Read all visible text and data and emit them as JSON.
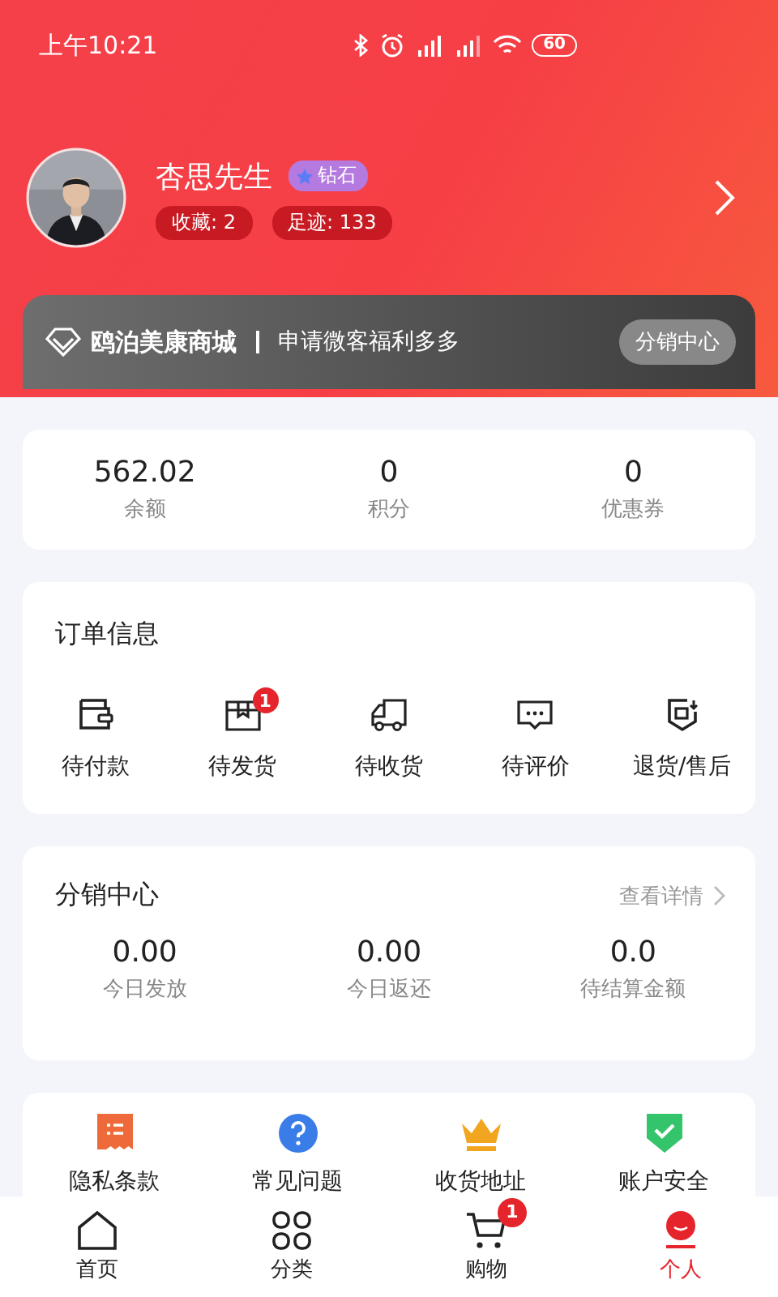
{
  "status_bar": {
    "time": "上午10:21",
    "battery": "60"
  },
  "profile": {
    "name": "杏思先生",
    "level": "钻石",
    "stats": [
      "收藏: 2",
      "足迹: 133"
    ]
  },
  "banner": {
    "shop": "鸥泊美康商城",
    "slogan": "申请微客福利多多",
    "button": "分销中心"
  },
  "assets": [
    {
      "value": "562.02",
      "label": "余额"
    },
    {
      "value": "0",
      "label": "积分"
    },
    {
      "value": "0",
      "label": "优惠券"
    }
  ],
  "orders": {
    "title": "订单信息",
    "items": [
      {
        "kind": "wallet",
        "label": "待付款"
      },
      {
        "kind": "box",
        "label": "待发货",
        "badge": "1"
      },
      {
        "kind": "truck",
        "label": "待收货"
      },
      {
        "kind": "chat",
        "label": "待评价"
      },
      {
        "kind": "return",
        "label": "退货/售后"
      }
    ]
  },
  "distribution": {
    "title": "分销中心",
    "link": "查看详情",
    "stats": [
      {
        "value": "0.00",
        "label": "今日发放"
      },
      {
        "value": "0.00",
        "label": "今日返还"
      },
      {
        "value": "0.0",
        "label": "待结算金额"
      }
    ]
  },
  "services": [
    {
      "kind": "receipt",
      "label": "隐私条款"
    },
    {
      "kind": "question",
      "label": "常见问题"
    },
    {
      "kind": "crown",
      "label": "收货地址"
    },
    {
      "kind": "shield",
      "label": "账户安全"
    }
  ],
  "tabbar": [
    {
      "kind": "home",
      "label": "首页",
      "selected": false
    },
    {
      "kind": "grid",
      "label": "分类",
      "selected": false
    },
    {
      "kind": "cart",
      "label": "购物",
      "selected": false,
      "badge": "1"
    },
    {
      "kind": "person",
      "label": "个人",
      "selected": true
    }
  ]
}
